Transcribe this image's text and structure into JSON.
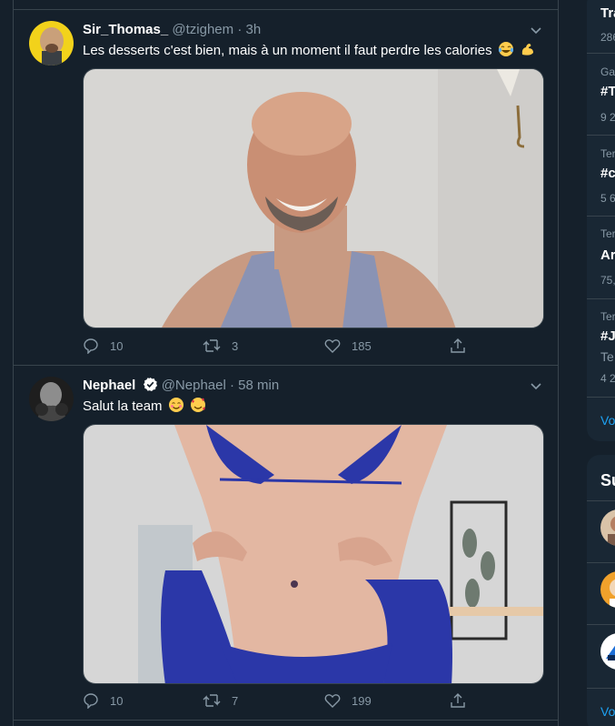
{
  "tweets": [
    {
      "name": "Sir_Thomas_",
      "handle": "@tzighem",
      "separator": "·",
      "time": "3h",
      "text": "Les desserts c'est bien, mais à un moment il faut perdre les calories",
      "emojis": [
        "face-with-tears-of-joy",
        "flexed-biceps"
      ],
      "verified": false,
      "replies": "10",
      "retweets": "3",
      "likes": "185"
    },
    {
      "name": "Nephael",
      "handle": "@Nephael",
      "separator": "·",
      "time": "58 min",
      "text": "Salut la team",
      "emojis": [
        "smiling-face",
        "smiling-face-with-hearts"
      ],
      "verified": true,
      "replies": "10",
      "retweets": "7",
      "likes": "199"
    }
  ],
  "sidebar": {
    "trends_title": "Tra",
    "items": [
      {
        "small_top": "286",
        "big": "",
        "small_bottom": ""
      },
      {
        "small_top": "Ga",
        "big": "#T",
        "small_bottom": "9 2"
      },
      {
        "small_top": "Ter",
        "big": "#c",
        "small_bottom": "5 6"
      },
      {
        "small_top": "Ter",
        "big": "Ar",
        "small_bottom": "75,"
      },
      {
        "small_top": "Ter",
        "big": "#J",
        "small_bottom": "Te"
      },
      {
        "small_top": "",
        "big": "",
        "small_bottom": "4 2"
      }
    ],
    "show_more": "Vo",
    "suggest_title": "Su",
    "show_more_2": "Vo"
  },
  "colors": {
    "background": "#15202b",
    "panel": "#192734",
    "border": "#38444d",
    "muted": "#8899a6",
    "accent": "#1da1f2"
  }
}
